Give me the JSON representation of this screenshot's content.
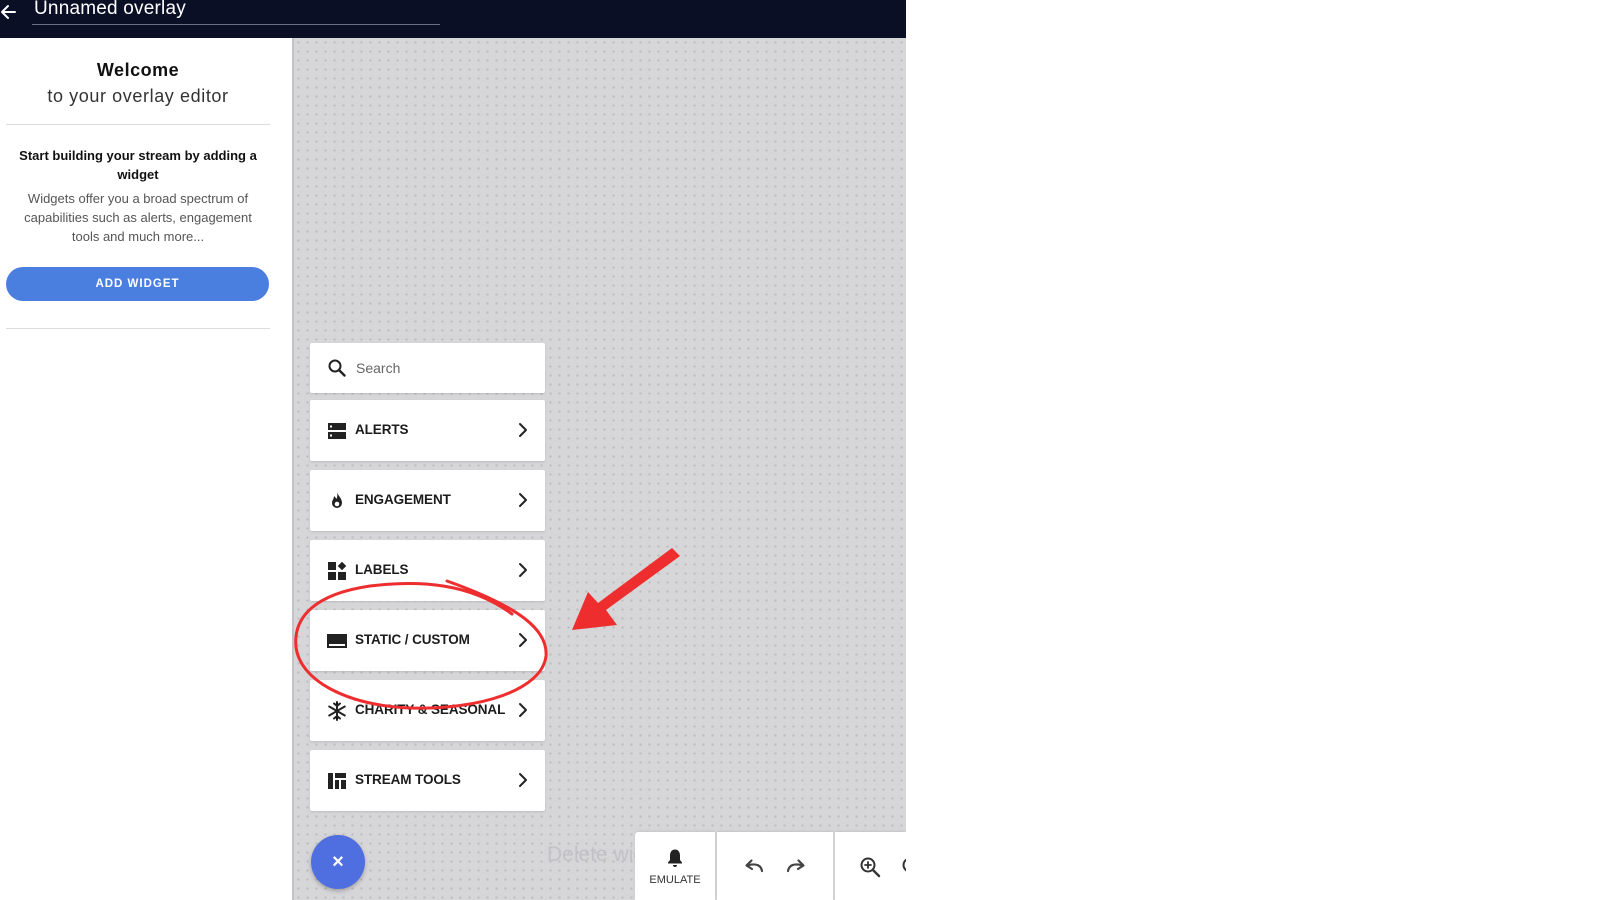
{
  "header": {
    "title": "Unnamed overlay",
    "back_icon": "arrow-left-icon"
  },
  "welcome": {
    "title": "Welcome",
    "subtitle": "to your overlay editor",
    "heading": "Start building your stream by adding a widget",
    "description": "Widgets offer you a broad spectrum of capabilities such as alerts, engagement tools and much more...",
    "add_widget_label": "ADD WIDGET"
  },
  "widget_menu": {
    "search_placeholder": "Search",
    "items": [
      {
        "label": "ALERTS",
        "icon": "alerts-icon"
      },
      {
        "label": "ENGAGEMENT",
        "icon": "flame-icon"
      },
      {
        "label": "LABELS",
        "icon": "labels-icon"
      },
      {
        "label": "STATIC / CUSTOM",
        "icon": "static-custom-icon"
      },
      {
        "label": "CHARITY & SEASONAL",
        "icon": "snowflake-icon"
      },
      {
        "label": "STREAM TOOLS",
        "icon": "stream-tools-icon"
      }
    ]
  },
  "canvas": {
    "close_label": "×",
    "delete_hint": "Delete widget"
  },
  "toolbar": {
    "emulate_label": "EMULATE"
  },
  "colors": {
    "topbar": "#0b0f26",
    "primary": "#4a7fe0",
    "fab": "#4f6fe0",
    "annotation": "#ee2e2e"
  }
}
